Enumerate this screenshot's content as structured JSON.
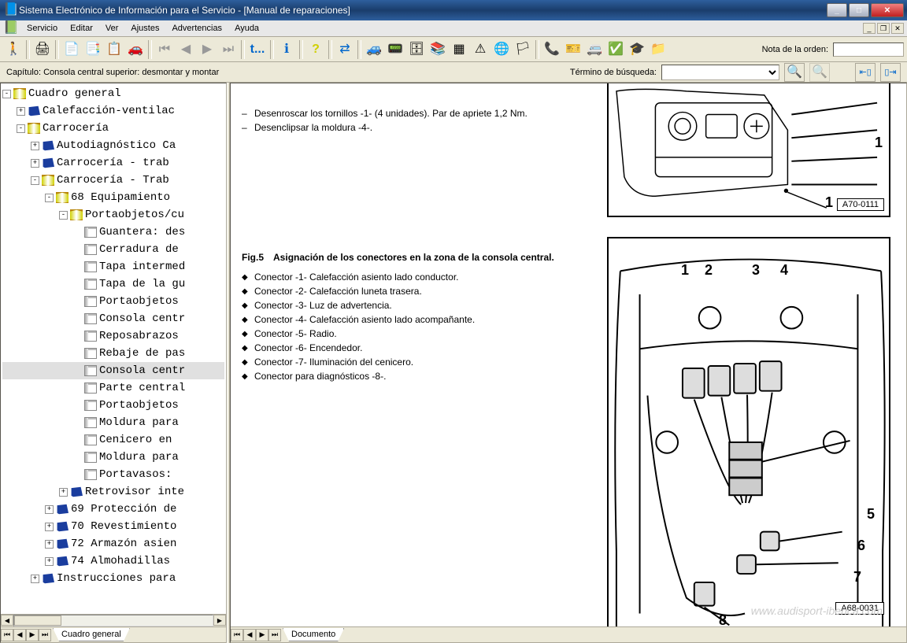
{
  "window": {
    "title": "Sistema Electrónico de Información para el Servicio - [Manual de reparaciones]"
  },
  "menu": {
    "items": [
      "Servicio",
      "Editar",
      "Ver",
      "Ajustes",
      "Advertencias",
      "Ayuda"
    ]
  },
  "toolbar": {
    "order_note_label": "Nota de la orden:",
    "order_note_value": ""
  },
  "chapter": {
    "label": "Capítulo: Consola central superior: desmontar y montar",
    "search_label": "Término de búsqueda:",
    "search_value": ""
  },
  "tree": [
    {
      "lvl": 0,
      "pm": "-",
      "icon": "book-open",
      "label": "Cuadro general"
    },
    {
      "lvl": 1,
      "pm": "+",
      "icon": "book-closed",
      "label": "Calefacción-ventilac"
    },
    {
      "lvl": 1,
      "pm": "-",
      "icon": "book-open",
      "label": "Carrocería"
    },
    {
      "lvl": 2,
      "pm": "+",
      "icon": "book-closed",
      "label": "Autodiagnóstico Ca"
    },
    {
      "lvl": 2,
      "pm": "+",
      "icon": "book-closed",
      "label": "Carrocería - trab"
    },
    {
      "lvl": 2,
      "pm": "-",
      "icon": "book-open",
      "label": "Carrocería - Trab"
    },
    {
      "lvl": 3,
      "pm": "-",
      "icon": "book-open",
      "label": "68 Equipamiento"
    },
    {
      "lvl": 4,
      "pm": "-",
      "icon": "book-open",
      "label": "Portaobjetos/cu"
    },
    {
      "lvl": 5,
      "pm": " ",
      "icon": "page",
      "label": "Guantera: des"
    },
    {
      "lvl": 5,
      "pm": " ",
      "icon": "page",
      "label": "Cerradura de"
    },
    {
      "lvl": 5,
      "pm": " ",
      "icon": "page",
      "label": "Tapa intermed"
    },
    {
      "lvl": 5,
      "pm": " ",
      "icon": "page",
      "label": "Tapa de la gu"
    },
    {
      "lvl": 5,
      "pm": " ",
      "icon": "page",
      "label": "Portaobjetos"
    },
    {
      "lvl": 5,
      "pm": " ",
      "icon": "page",
      "label": "Consola centr"
    },
    {
      "lvl": 5,
      "pm": " ",
      "icon": "page",
      "label": "Reposabrazos"
    },
    {
      "lvl": 5,
      "pm": " ",
      "icon": "page",
      "label": "Rebaje de pas"
    },
    {
      "lvl": 5,
      "pm": " ",
      "icon": "page",
      "label": "Consola centr",
      "selected": true
    },
    {
      "lvl": 5,
      "pm": " ",
      "icon": "page",
      "label": "Parte central"
    },
    {
      "lvl": 5,
      "pm": " ",
      "icon": "page",
      "label": "Portaobjetos"
    },
    {
      "lvl": 5,
      "pm": " ",
      "icon": "page",
      "label": "Moldura para"
    },
    {
      "lvl": 5,
      "pm": " ",
      "icon": "page",
      "label": "Cenicero en"
    },
    {
      "lvl": 5,
      "pm": " ",
      "icon": "page",
      "label": "Moldura para"
    },
    {
      "lvl": 5,
      "pm": " ",
      "icon": "page",
      "label": "Portavasos: "
    },
    {
      "lvl": 4,
      "pm": "+",
      "icon": "book-closed",
      "label": "Retrovisor inte"
    },
    {
      "lvl": 3,
      "pm": "+",
      "icon": "book-closed",
      "label": "69 Protección de"
    },
    {
      "lvl": 3,
      "pm": "+",
      "icon": "book-closed",
      "label": "70 Revestimiento"
    },
    {
      "lvl": 3,
      "pm": "+",
      "icon": "book-closed",
      "label": "72 Armazón asien"
    },
    {
      "lvl": 3,
      "pm": "+",
      "icon": "book-closed",
      "label": "74 Almohadillas"
    },
    {
      "lvl": 2,
      "pm": "+",
      "icon": "book-closed",
      "label": "Instrucciones para"
    }
  ],
  "doc": {
    "step1": "Desenroscar los tornillos -1- (4 unidades). Par de apriete 1,2 Nm.",
    "step2": "Desenclipsar la moldura -4-.",
    "fig5_num": "Fig.5",
    "fig5_title": "Asignación de los conectores en la zona de la consola central.",
    "connectors": [
      "Conector -1- Calefacción asiento lado conductor.",
      "Conector -2- Calefacción luneta trasera.",
      "Conector -3- Luz de advertencia.",
      "Conector -4- Calefacción asiento lado acompañante.",
      "Conector -5- Radio.",
      "Conector -6- Encendedor.",
      "Conector -7- Iluminación del cenicero.",
      "Conector para diagnósticos -8-."
    ],
    "fig_label_top": "A70-0111",
    "fig_label_bottom": "A68-0031"
  },
  "tabs": {
    "left": "Cuadro general",
    "right": "Documento"
  },
  "watermark": "www.audisport-iberica.com"
}
